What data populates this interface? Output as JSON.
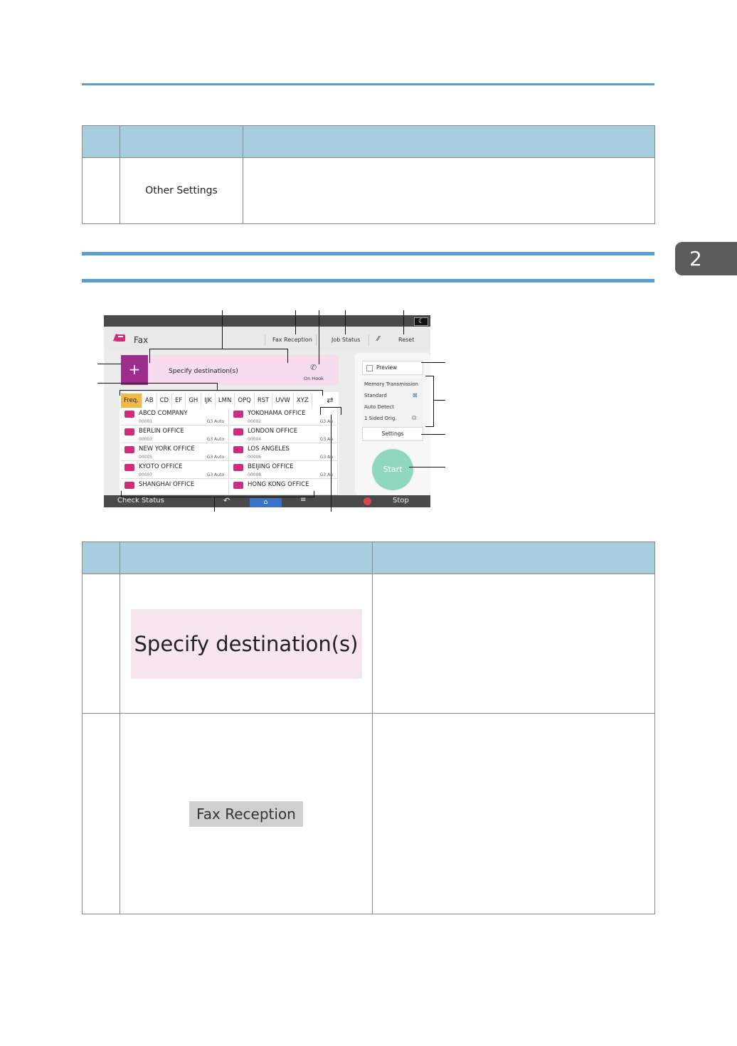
{
  "chapter_tab": "2",
  "table1": {
    "row1_label": "Other Settings"
  },
  "panel": {
    "title": "Fax",
    "header_buttons": {
      "fax_reception": "Fax Reception",
      "job_status": "Job Status",
      "reset": "Reset"
    },
    "dest_label": "Specify destination(s)",
    "on_hook": "On Hook",
    "plus_glyph": "+",
    "tabs": [
      "Freq.",
      "AB",
      "CD",
      "EF",
      "GH",
      "IJK",
      "LMN",
      "OPQ",
      "RST",
      "UVW",
      "XYZ"
    ],
    "entries": [
      {
        "name": "ABCD COMPANY",
        "number": "00001",
        "type": "G3 Auto"
      },
      {
        "name": "YOKOHAMA OFFICE",
        "number": "00002",
        "type": "G3 Au"
      },
      {
        "name": "BERLIN OFFICE",
        "number": "00003",
        "type": "G3 Auto"
      },
      {
        "name": "LONDON OFFICE",
        "number": "00004",
        "type": "G3 Au"
      },
      {
        "name": "NEW YORK OFFICE",
        "number": "00005",
        "type": "G3 Auto"
      },
      {
        "name": "LOS ANGELES",
        "number": "00006",
        "type": "G3 Au"
      },
      {
        "name": "KYOTO OFFICE",
        "number": "00007",
        "type": "G3 Auto"
      },
      {
        "name": "BEIJING OFFICE",
        "number": "00008",
        "type": "G3 Au"
      },
      {
        "name": "SHANGHAI  OFFICE",
        "number": "",
        "type": ""
      },
      {
        "name": "HONG KONG OFFICE",
        "number": "",
        "type": ""
      }
    ],
    "preview": "Preview",
    "settings_lines": [
      "Memory Transmission",
      "Standard",
      "Auto Detect",
      "1 Sided Orig."
    ],
    "settings_button": "Settings",
    "start": "Start",
    "check_status": "Check Status",
    "stop": "Stop"
  },
  "table2": {
    "row1_sample": "Specify destination(s)",
    "row2_sample": "Fax Reception"
  }
}
